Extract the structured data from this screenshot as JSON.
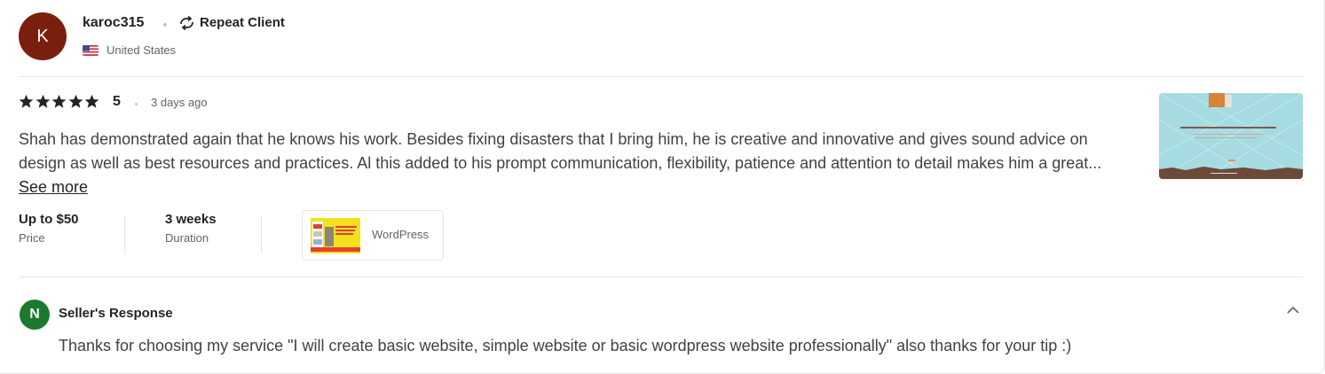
{
  "reviewer": {
    "avatar_letter": "K",
    "avatar_color": "#7a1f0e",
    "username": "karoc315",
    "badge": "Repeat Client",
    "country": "United States"
  },
  "review": {
    "rating": "5",
    "stars": 5,
    "date": "3 days ago",
    "text": "Shah has demonstrated again that he knows his work. Besides fixing disasters that I bring him, he is creative and innovative and gives sound advice on design as well as best resources and practices. Al this added to his prompt communication, flexibility, patience and attention to detail makes him a great...",
    "see_more": "See more"
  },
  "meta": {
    "price_value": "Up to $50",
    "price_label": "Price",
    "duration_value": "3 weeks",
    "duration_label": "Duration"
  },
  "gig": {
    "label": "WordPress"
  },
  "seller_response": {
    "avatar_letter": "N",
    "avatar_color": "#1b7a2e",
    "title": "Seller's Response",
    "text": "Thanks for choosing my service \"I will create basic website, simple website or basic wordpress website professionally\" also thanks for your tip :)"
  }
}
